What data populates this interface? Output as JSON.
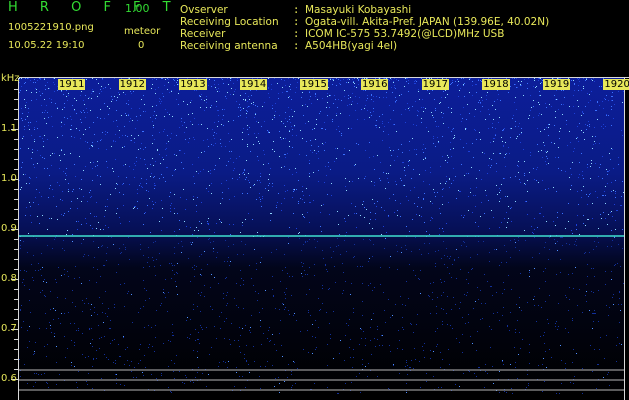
{
  "header": {
    "app_title": "H R O F F T",
    "version": "1.00",
    "filename": "1005221910.png",
    "datetime": "10.05.22 19:10",
    "meteor_label": "meteor",
    "meteor_count": "0"
  },
  "info": [
    {
      "label": "Ovserver",
      "value": "Masayuki Kobayashi"
    },
    {
      "label": "Receiving Location",
      "value": "Ogata-vill. Akita-Pref. JAPAN (139.96E, 40.02N)"
    },
    {
      "label": "Receiver",
      "value": "ICOM IC-575 53.7492(@LCD)MHz USB"
    },
    {
      "label": "Receiving antenna",
      "value": "A504HB(yagi 4el)"
    }
  ],
  "colon": ":",
  "axis": {
    "unit": "kHz",
    "freq_ticks": [
      "1.1",
      "1.0",
      "0.9",
      "0.8",
      "0.7",
      "0.6"
    ],
    "time_ticks": [
      "1911",
      "1912",
      "1913",
      "1914",
      "1915",
      "1916",
      "1917",
      "1918",
      "1919",
      "1920"
    ]
  },
  "colors": {
    "background": "#000000",
    "header_green": "#33dd33",
    "header_yellow": "#e8e85a",
    "spectrum_blue": "#1030c0",
    "carrier_line": "#40e0d0"
  }
}
